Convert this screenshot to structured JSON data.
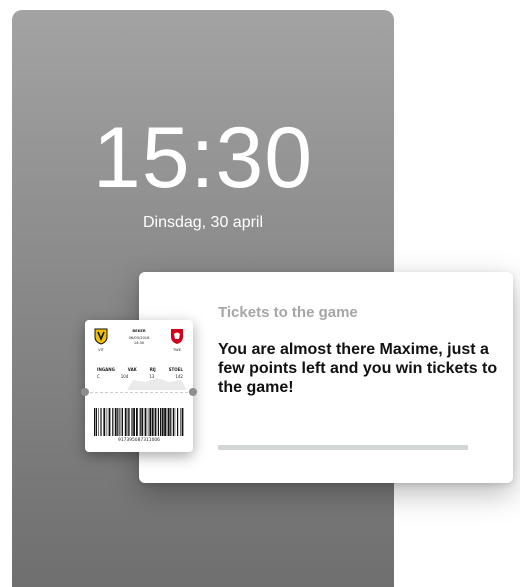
{
  "lockscreen": {
    "time": "15:30",
    "date": "Dinsdag, 30 april"
  },
  "notification": {
    "title": "Tickets to the game",
    "body": "You are almost there Maxime, just a few points left and you win tickets to the game!",
    "progress": 0
  },
  "ticket": {
    "header": "BEKER",
    "date": "06/05/2018",
    "time": "14:30",
    "team_left_label": "VIT",
    "team_right_label": "TWE",
    "seat_headers": [
      "INGANG",
      "VAK",
      "RIJ",
      "STOEL"
    ],
    "seat_values": [
      "C",
      "104",
      "13",
      "142"
    ],
    "barcode_number": "917395087311006",
    "left_crest_colors": [
      "#f2c200",
      "#111111"
    ],
    "right_crest_color": "#d0021b"
  }
}
